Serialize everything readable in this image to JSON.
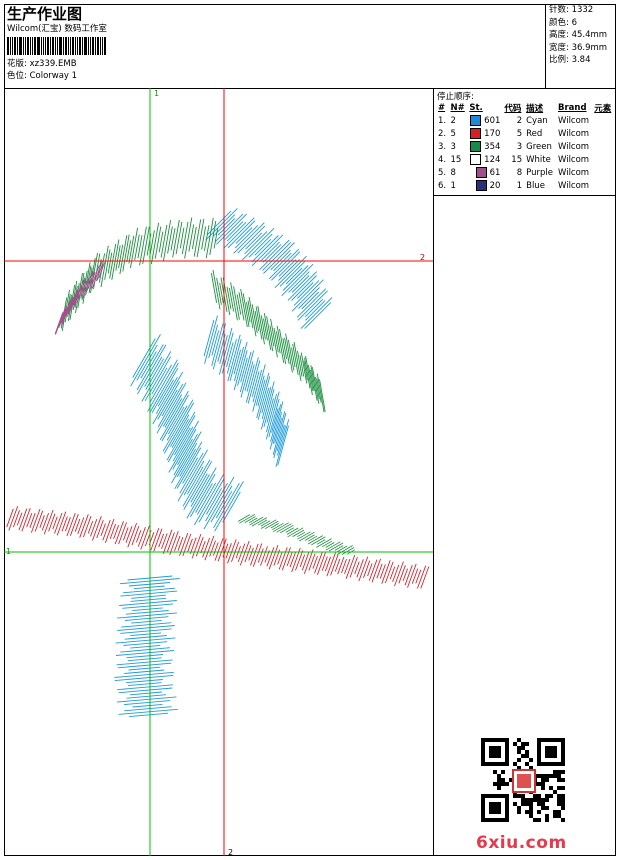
{
  "header": {
    "title": "生产作业图",
    "company": "Wilcom(汇宝) 数码工作室",
    "design_label": "花版: xz339.EMB",
    "colorway_label": "色位: Colorway 1"
  },
  "stats": [
    "针数: 1332",
    "颜色: 6",
    "高度: 45.4mm",
    "宽度: 36.9mm",
    "比例: 3.84"
  ],
  "stop_sequence": {
    "title": "停止顺序:",
    "headers": [
      "#",
      "N#",
      "St.",
      "代码",
      "描述",
      "Brand",
      "元素"
    ],
    "rows": [
      {
        "idx": "1.",
        "n": "2",
        "color": "#1e8ad3",
        "st": "601",
        "code": "2",
        "desc": "Cyan",
        "brand": "Wilcom"
      },
      {
        "idx": "2.",
        "n": "5",
        "color": "#d42020",
        "st": "170",
        "code": "5",
        "desc": "Red",
        "brand": "Wilcom"
      },
      {
        "idx": "3.",
        "n": "3",
        "color": "#17894a",
        "st": "354",
        "code": "3",
        "desc": "Green",
        "brand": "Wilcom"
      },
      {
        "idx": "4.",
        "n": "15",
        "color": "#ffffff",
        "st": "124",
        "code": "15",
        "desc": "White",
        "brand": "Wilcom"
      },
      {
        "idx": "5.",
        "n": "8",
        "color": "#a04f8a",
        "st": "61",
        "code": "8",
        "desc": "Purple",
        "brand": "Wilcom"
      },
      {
        "idx": "6.",
        "n": "1",
        "color": "#2b2f7a",
        "st": "20",
        "code": "1",
        "desc": "Blue",
        "brand": "Wilcom"
      }
    ]
  },
  "guides": {
    "h1": "1",
    "h2": "2",
    "v1": "1",
    "v2": "2",
    "h_color": "#ff0000",
    "v_color": "#00c000"
  },
  "watermark": "6xiu.com",
  "stitch_colors": {
    "cyan": "#1e9bd8",
    "green": "#1a8f3e",
    "red": "#d4262c",
    "purple": "#a04f8a"
  }
}
